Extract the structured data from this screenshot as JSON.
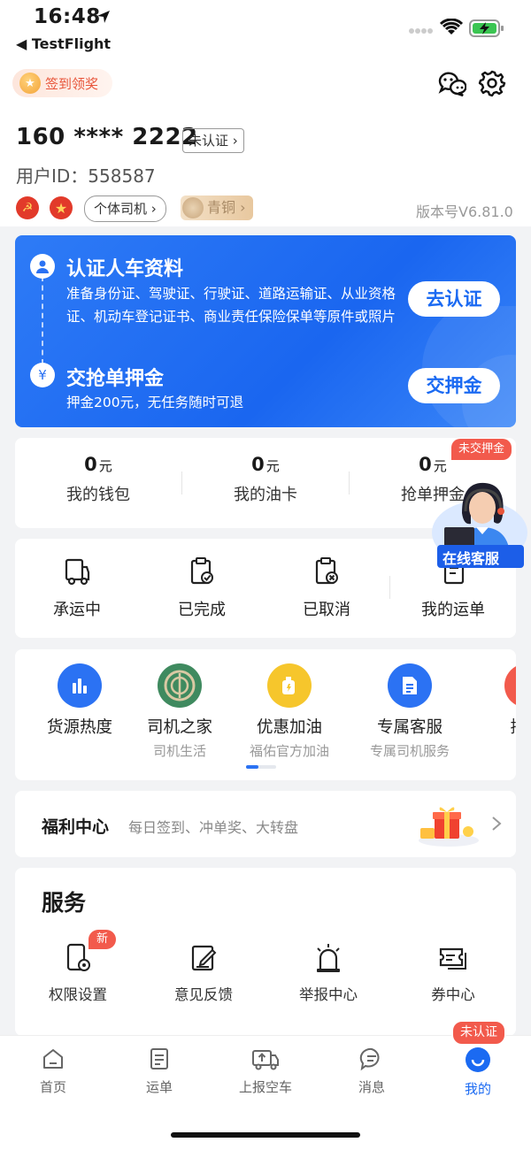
{
  "status_bar": {
    "time": "16:48",
    "back_app": "◀ TestFlight"
  },
  "header": {
    "sign_in_label": "签到领奖",
    "phone": "160 **** 2222",
    "verify_status": "未认证 ›",
    "user_id": "用户ID：558587",
    "driver_type": "个体司机 ›",
    "level": "青铜 ›",
    "version": "版本号V6.81.0"
  },
  "verify_card": {
    "step1_title": "认证人车资料",
    "step1_desc": "准备身份证、驾驶证、行驶证、道路运输证、从业资格证、机动车登记证书、商业责任保险保单等原件或照片",
    "step1_button": "去认证",
    "step2_title": "交抢单押金",
    "step2_desc": "押金200元，无任务随时可退",
    "step2_button": "交押金"
  },
  "wallet": {
    "deposit_badge": "未交押金",
    "items": [
      {
        "value": "0",
        "unit": "元",
        "label": "我的钱包"
      },
      {
        "value": "0",
        "unit": "元",
        "label": "我的油卡"
      },
      {
        "value": "0",
        "unit": "元",
        "label": "抢单押金"
      }
    ]
  },
  "online_service": "在线客服",
  "orders": [
    {
      "label": "承运中",
      "icon": "truck-icon"
    },
    {
      "label": "已完成",
      "icon": "clipboard-check-icon"
    },
    {
      "label": "已取消",
      "icon": "clipboard-cancel-icon"
    },
    {
      "label": "我的运单",
      "icon": "document-icon"
    }
  ],
  "features": [
    {
      "title": "货源热度",
      "subtitle": "",
      "color": "#2b72f3"
    },
    {
      "title": "司机之家",
      "subtitle": "司机生活",
      "color": "#3f8a5f"
    },
    {
      "title": "优惠加油",
      "subtitle": "福佑官方加油",
      "color": "#f6c62c"
    },
    {
      "title": "专属客服",
      "subtitle": "专属司机服务",
      "color": "#2b72f3"
    },
    {
      "title": "摇签",
      "subtitle": "",
      "color": "#f25a4c"
    }
  ],
  "welfare": {
    "title": "福利中心",
    "desc": "每日签到、冲单奖、大转盘"
  },
  "services": {
    "title": "服务",
    "new_badge": "新",
    "items": [
      {
        "label": "权限设置"
      },
      {
        "label": "意见反馈"
      },
      {
        "label": "举报中心"
      },
      {
        "label": "券中心"
      }
    ]
  },
  "tabbar": {
    "badge": "未认证",
    "items": [
      {
        "label": "首页"
      },
      {
        "label": "运单"
      },
      {
        "label": "上报空车"
      },
      {
        "label": "消息"
      },
      {
        "label": "我的"
      }
    ]
  },
  "colors": {
    "accent": "#1b6af2",
    "alert": "#f25a4c"
  }
}
